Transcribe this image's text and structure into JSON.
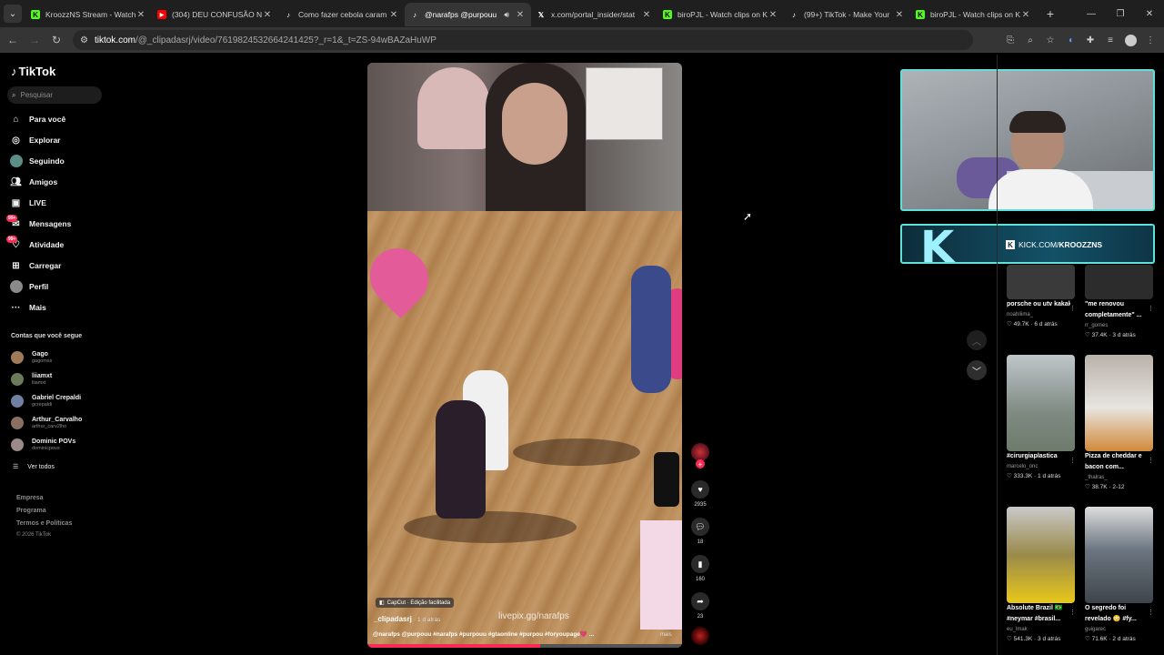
{
  "tabs": [
    {
      "title": "KroozzNS Stream - Watch",
      "favicon": "kick-icon",
      "active": false
    },
    {
      "title": "(304) DEU CONFUSÃO N",
      "favicon": "youtube-icon",
      "active": false
    },
    {
      "title": "Como fazer cebola caram",
      "favicon": "tiktok-icon",
      "active": false
    },
    {
      "title": "@narafps @purpouu",
      "favicon": "tiktok-icon",
      "active": true,
      "audio": true
    },
    {
      "title": "x.com/portal_insider/stat",
      "favicon": "x-icon",
      "active": false
    },
    {
      "title": "biroPJL - Watch clips on K",
      "favicon": "kick-icon",
      "active": false
    },
    {
      "title": "(99+) TikTok - Make Your",
      "favicon": "tiktok-icon",
      "active": false
    },
    {
      "title": "biroPJL - Watch clips on K",
      "favicon": "kick-icon",
      "active": false
    }
  ],
  "address": {
    "domain": "tiktok.com",
    "path": "/@_clipadasrj/video/7619824532664241425?_r=1&_t=ZS-94wBAZaHuWP"
  },
  "sidebar": {
    "logo": "TikTok",
    "search_placeholder": "Pesquisar",
    "nav": [
      {
        "label": "Para você",
        "icon": "home-icon"
      },
      {
        "label": "Explorar",
        "icon": "compass-icon"
      },
      {
        "label": "Seguindo",
        "icon": "following-avatar-icon"
      },
      {
        "label": "Amigos",
        "icon": "friends-icon"
      },
      {
        "label": "LIVE",
        "icon": "live-icon"
      },
      {
        "label": "Mensagens",
        "icon": "messages-icon",
        "badge": "99+"
      },
      {
        "label": "Atividade",
        "icon": "activity-icon",
        "badge": "99+"
      },
      {
        "label": "Carregar",
        "icon": "upload-icon"
      },
      {
        "label": "Perfil",
        "icon": "profile-avatar-icon"
      },
      {
        "label": "Mais",
        "icon": "more-icon"
      }
    ],
    "following_title": "Contas que você segue",
    "following": [
      {
        "name": "Gago",
        "handle": "gagomss"
      },
      {
        "name": "liiamxt",
        "handle": "liiamxt"
      },
      {
        "name": "Gabriel Crepaldi",
        "handle": "gcrepaldi"
      },
      {
        "name": "Arthur_Carvalho",
        "handle": "arthur_carv2lho"
      },
      {
        "name": "Dominic POVs",
        "handle": "dominicpovs"
      }
    ],
    "see_all": "Ver todos",
    "footer": [
      "Empresa",
      "Programa",
      "Termos e Políticas",
      "© 2026 TikTok"
    ]
  },
  "video": {
    "capcut_label": "CapCut · Edição facilitada",
    "watermark": "livepix.gg/narafps",
    "author": "_clipadasrj",
    "time_ago": "· 1 d atrás",
    "caption": "@narafps @purpouu #narafps #purpouu #gtaonline #purpou #foryoupage💗 ...",
    "more_label": "mais",
    "progress": 0.55
  },
  "actions": [
    {
      "name": "like",
      "icon": "heart-icon",
      "count": "2935"
    },
    {
      "name": "comment",
      "icon": "comment-icon",
      "count": "18"
    },
    {
      "name": "save",
      "icon": "bookmark-icon",
      "count": "160"
    },
    {
      "name": "share",
      "icon": "share-icon",
      "count": "23"
    }
  ],
  "kick": {
    "url_prefix": "KICK.COM/",
    "channel": "KROOZZNS"
  },
  "suggested": [
    {
      "title": "porsche ou utv kakakaka #fyp...",
      "user": "noahliima_",
      "likes": "49.7K",
      "ago": "6 d atrás",
      "color": "#3a3a3a"
    },
    {
      "title": "\"me renovou completamente\" ...",
      "user": "rr_gomes",
      "likes": "37.4K",
      "ago": "3 d atrás",
      "color": "#2c2c2c"
    },
    {
      "title": "#cirurgiaplastica",
      "user": "marcelo_onc",
      "likes": "333.3K",
      "ago": "1 d atrás",
      "color": "#6b7a6e"
    },
    {
      "title": "Pizza de cheddar e bacon com...",
      "user": "_thalras_",
      "likes": "38.7K",
      "ago": "2-12",
      "color": "#9a8a7c"
    },
    {
      "title": "Absolute Brazil 🇧🇷 #neymar #brasil...",
      "user": "eu_lmak",
      "likes": "541.3K",
      "ago": "3 d atrás",
      "color": "#5b5e2c"
    },
    {
      "title": "O segredo foi revelado 😳 #fy...",
      "user": "guigarec",
      "likes": "71.6K",
      "ago": "2 d atrás",
      "color": "#5a6068"
    }
  ],
  "colors": {
    "accent": "#fe2c55",
    "kick_green": "#53fc18",
    "overlay_border": "#5fe0d8"
  }
}
